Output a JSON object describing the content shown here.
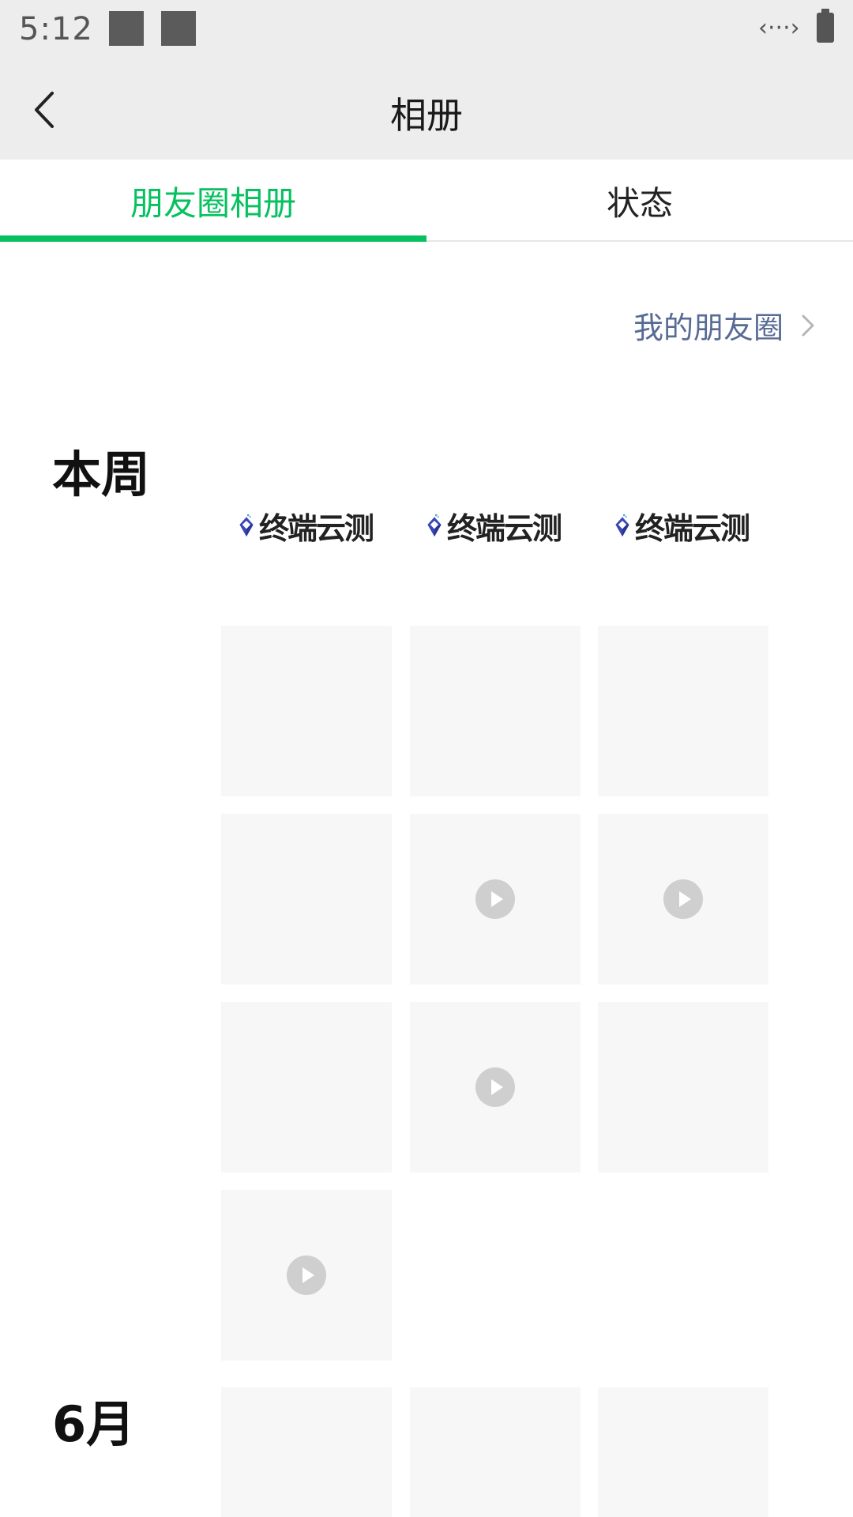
{
  "status_bar": {
    "time": "5:12",
    "data_icon": "‹···›"
  },
  "header": {
    "title": "相册"
  },
  "tabs": [
    {
      "label": "朋友圈相册",
      "active": true
    },
    {
      "label": "状态",
      "active": false
    }
  ],
  "my_moments": {
    "label": "我的朋友圈"
  },
  "sections": [
    {
      "label": "本周",
      "logos": [
        {
          "text": "终端云测",
          "icon": "logo-icon"
        },
        {
          "text": "终端云测",
          "icon": "logo-icon"
        },
        {
          "text": "终端云测",
          "icon": "logo-icon"
        }
      ],
      "tiles": [
        {
          "video": false
        },
        {
          "video": false
        },
        {
          "video": false
        },
        {
          "video": false
        },
        {
          "video": true
        },
        {
          "video": true
        },
        {
          "video": false
        },
        {
          "video": true
        },
        {
          "video": false
        },
        {
          "video": true
        }
      ]
    },
    {
      "label": "6月",
      "tiles": [
        {
          "video": false
        },
        {
          "video": false
        },
        {
          "video": false
        }
      ]
    }
  ],
  "colors": {
    "accent": "#07c160",
    "link": "#576b95",
    "tile_bg": "#f7f7f7",
    "bar_bg": "#ededed"
  }
}
